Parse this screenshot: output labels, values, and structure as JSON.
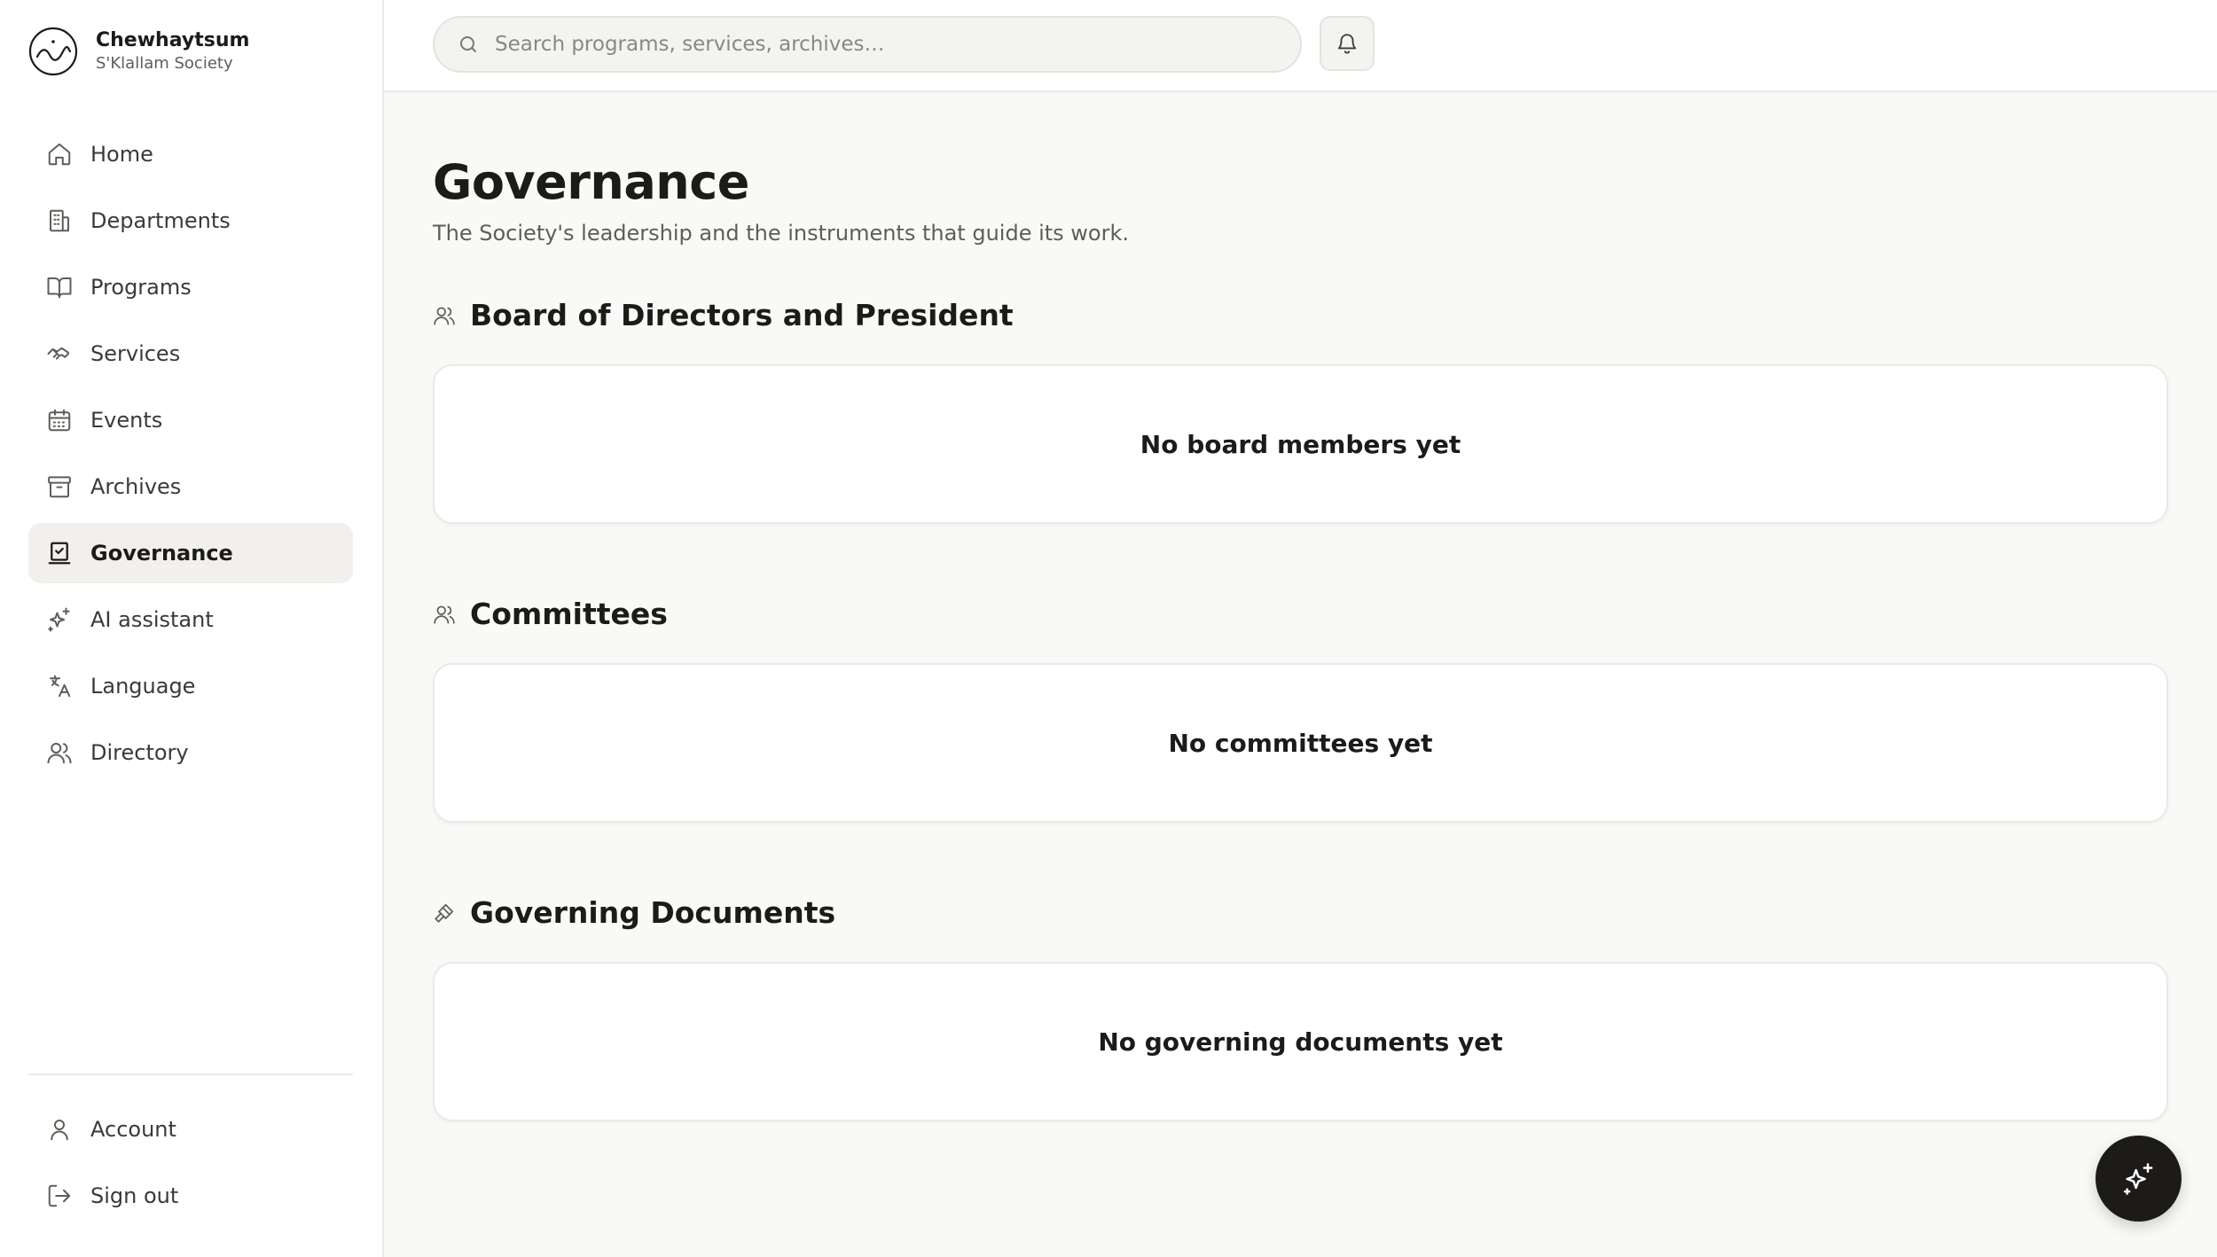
{
  "brand": {
    "name": "Chewhaytsum",
    "subtitle": "S'Klallam Society"
  },
  "sidebar": {
    "items": [
      {
        "label": "Home",
        "icon": "home-icon"
      },
      {
        "label": "Departments",
        "icon": "building-icon"
      },
      {
        "label": "Programs",
        "icon": "book-icon"
      },
      {
        "label": "Services",
        "icon": "handshake-icon"
      },
      {
        "label": "Events",
        "icon": "calendar-icon"
      },
      {
        "label": "Archives",
        "icon": "archive-icon"
      },
      {
        "label": "Governance",
        "icon": "vote-icon",
        "active": true
      },
      {
        "label": "AI assistant",
        "icon": "sparkles-icon"
      },
      {
        "label": "Language",
        "icon": "translate-icon"
      },
      {
        "label": "Directory",
        "icon": "users-icon"
      }
    ],
    "bottom_items": [
      {
        "label": "Account",
        "icon": "user-icon"
      },
      {
        "label": "Sign out",
        "icon": "sign-out-icon"
      }
    ]
  },
  "search": {
    "placeholder": "Search programs, services, archives…",
    "value": ""
  },
  "page": {
    "title": "Governance",
    "subtitle": "The Society's leadership and the instruments that guide its work."
  },
  "sections": [
    {
      "title": "Board of Directors and President",
      "icon": "users-icon",
      "empty": "No board members yet"
    },
    {
      "title": "Committees",
      "icon": "users-icon",
      "empty": "No committees yet"
    },
    {
      "title": "Governing Documents",
      "icon": "gavel-icon",
      "empty": "No governing documents yet"
    }
  ],
  "colors": {
    "accent": "#1c1b19",
    "active_nav_bg": "#f1f0ec",
    "page_bg": "#f9f9f7",
    "muted_text": "#5f5d58"
  }
}
